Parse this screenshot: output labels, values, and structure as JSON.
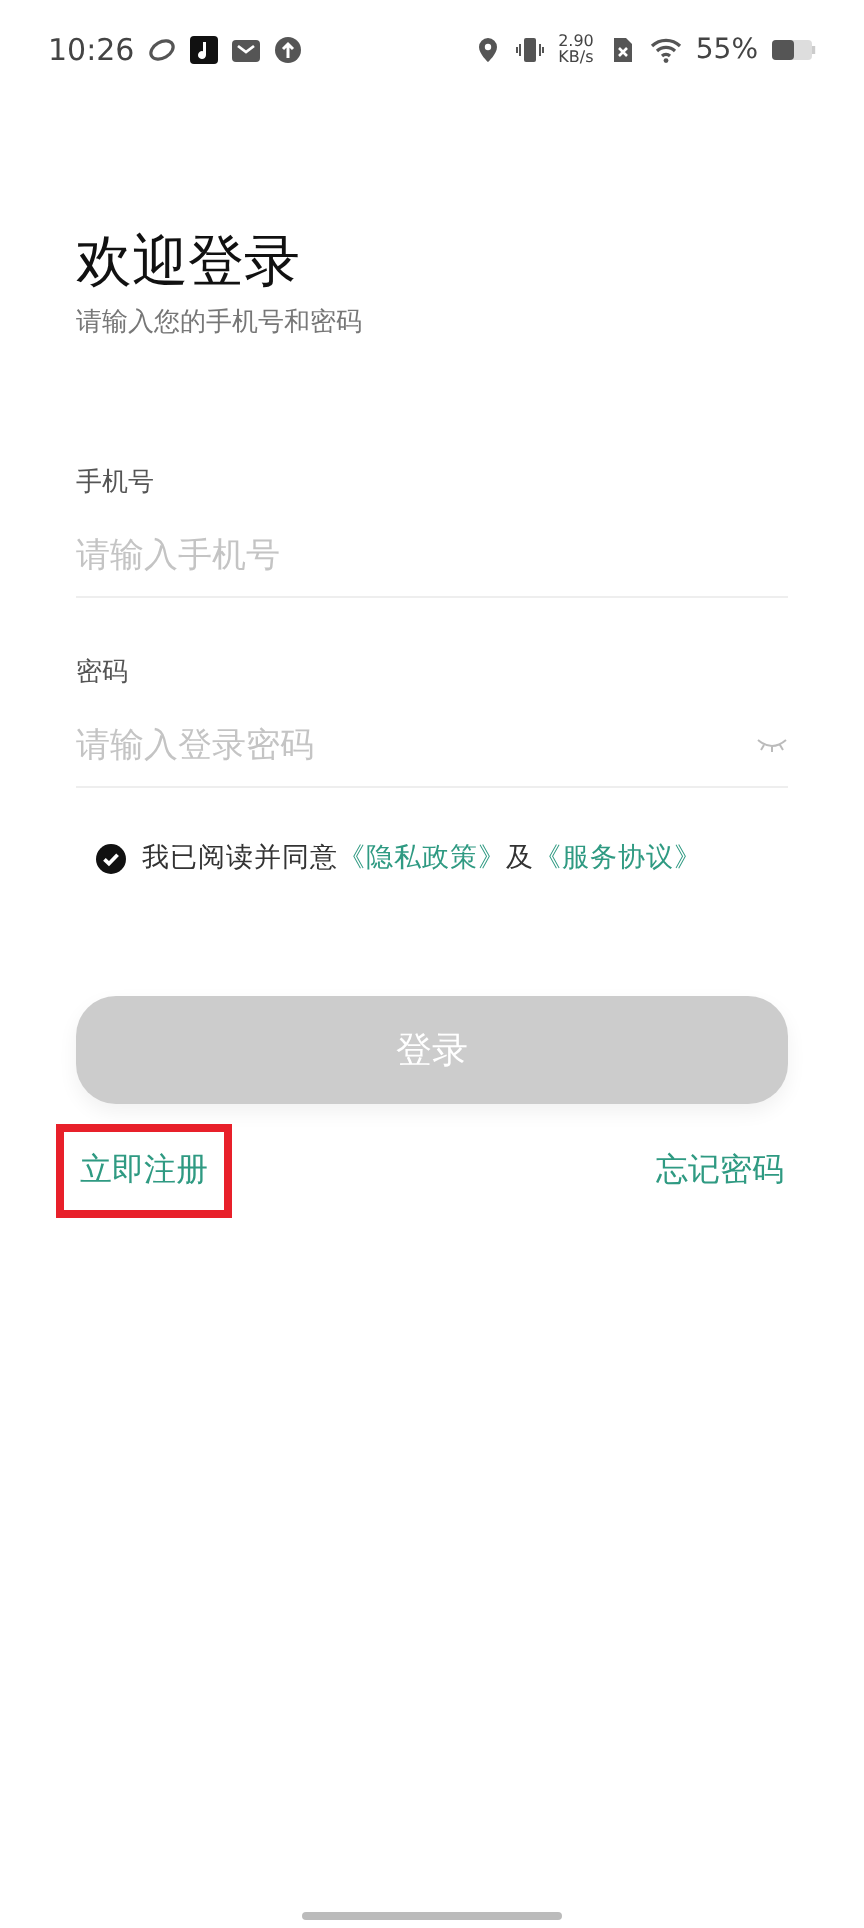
{
  "status_bar": {
    "time": "10:26",
    "network_speed_value": "2.90",
    "network_speed_unit": "KB/s",
    "battery": "55%"
  },
  "title": "欢迎登录",
  "subtitle": "请输入您的手机号和密码",
  "fields": [
    {
      "label": "手机号",
      "placeholder": "请输入手机号",
      "kind": "text"
    },
    {
      "label": "密码",
      "placeholder": "请输入登录密码",
      "kind": "password"
    }
  ],
  "agreement": {
    "checked": true,
    "parts": [
      {
        "kind": "text",
        "text": "我已阅读并同意"
      },
      {
        "kind": "link",
        "text": "《隐私政策》"
      },
      {
        "kind": "text",
        "text": "及"
      },
      {
        "kind": "link",
        "text": "《服务协议》"
      }
    ]
  },
  "login_button": {
    "label": "登录",
    "disabled": true
  },
  "links": [
    {
      "label": "立即注册",
      "highlighted": true
    },
    {
      "label": "忘记密码",
      "highlighted": false
    }
  ]
}
